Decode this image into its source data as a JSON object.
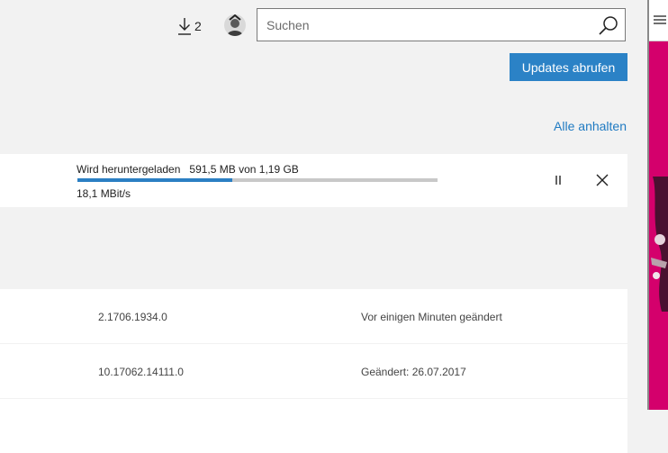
{
  "header": {
    "downloads_count": "2",
    "search_placeholder": "Suchen",
    "search_value": ""
  },
  "actions": {
    "updates_button": "Updates abrufen",
    "pause_all": "Alle anhalten"
  },
  "download": {
    "status": "Wird heruntergeladen",
    "size": "591,5 MB von 1,19 GB",
    "speed": "18,1 MBit/s",
    "progress_fraction": 0.43
  },
  "list": [
    {
      "version": "2.1706.1934.0",
      "changed": "Vor einigen Minuten geändert"
    },
    {
      "version": "10.17062.14111.0",
      "changed": "Geändert: 26.07.2017"
    },
    {
      "version": "",
      "changed": ""
    }
  ],
  "icons": {
    "download": "download-icon",
    "search": "search-icon",
    "pause": "pause-icon",
    "close": "close-icon",
    "menu": "hamburger-icon"
  },
  "colors": {
    "accent": "#2b82c6",
    "link": "#1f7ac2",
    "side_panel": "#d4006c"
  }
}
